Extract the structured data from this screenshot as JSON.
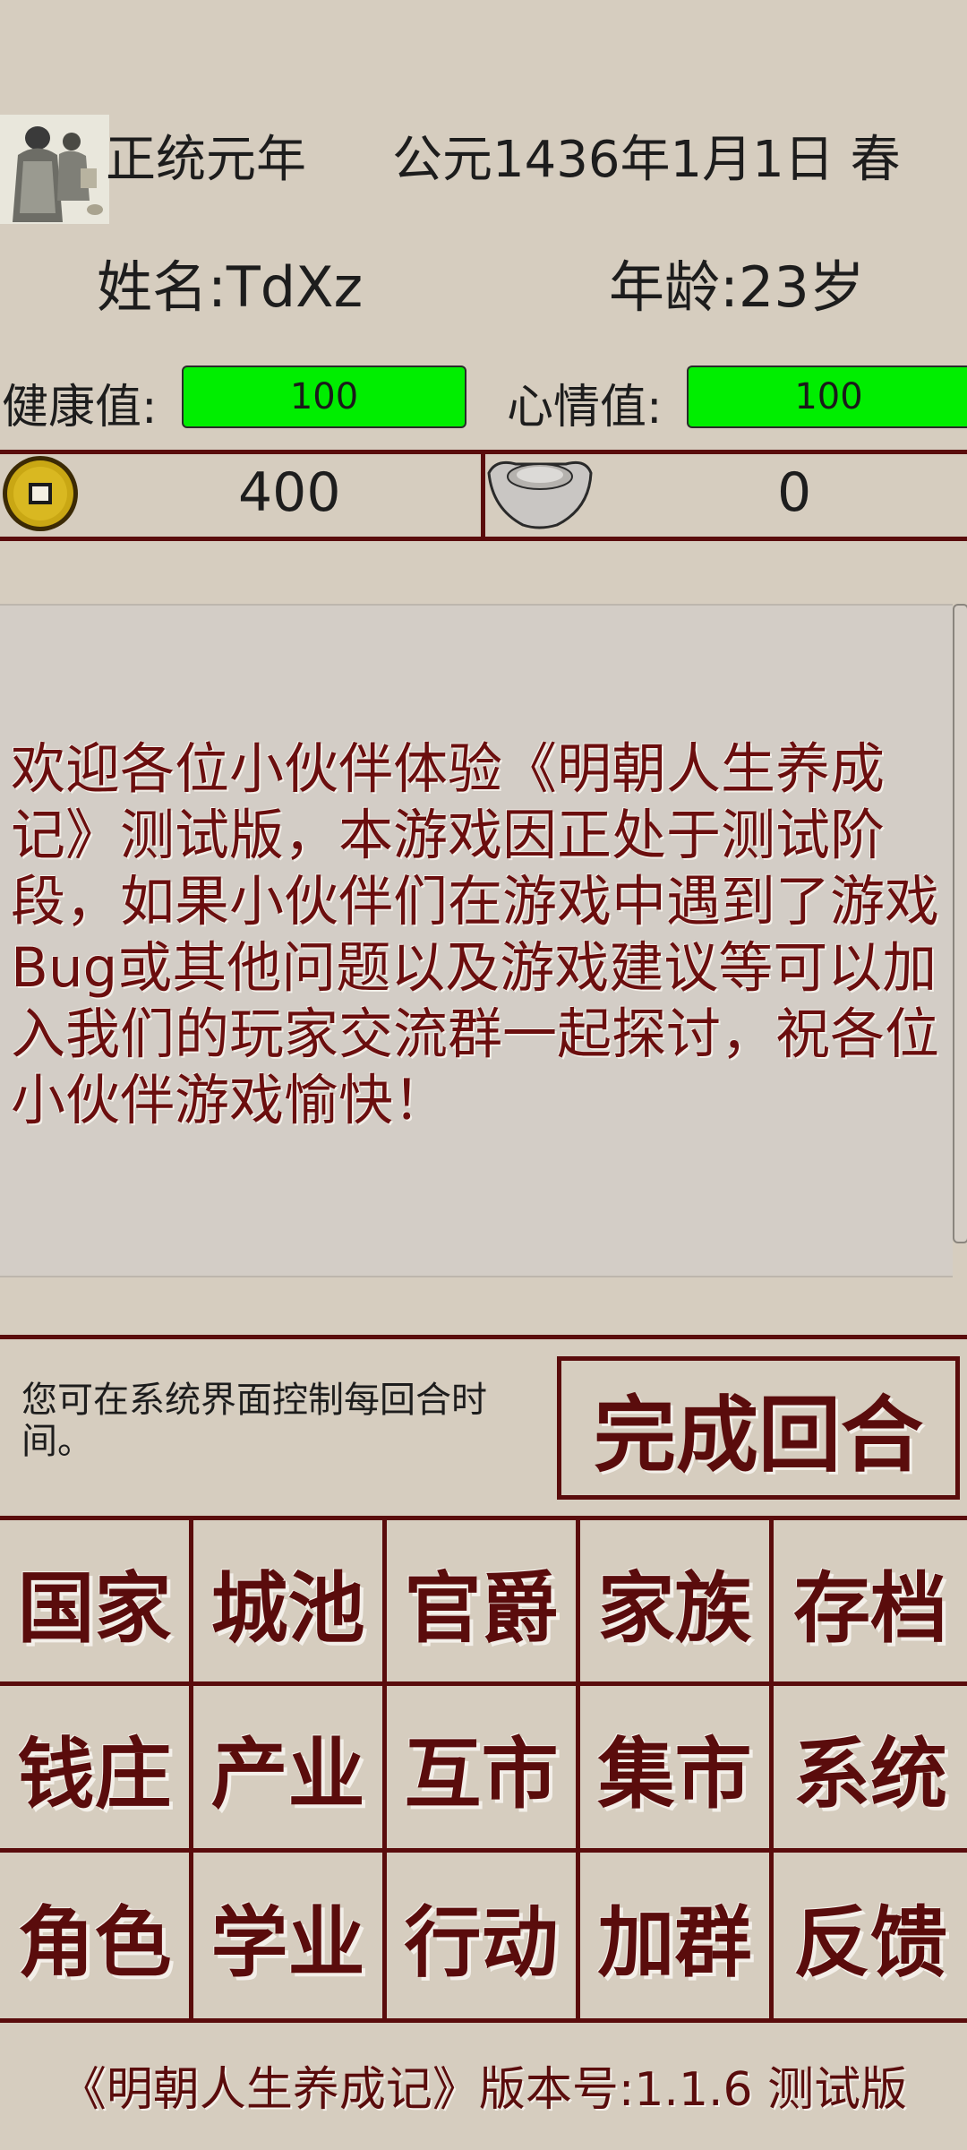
{
  "header": {
    "era": "正统元年",
    "date": "公元1436年1月1日 春",
    "name": "姓名:TdXz",
    "age": "年龄:23岁"
  },
  "stats": {
    "health_label": "健康值:",
    "health_value": "100",
    "mood_label": "心情值:",
    "mood_value": "100"
  },
  "currency": {
    "coins": "400",
    "silver": "0"
  },
  "message": "欢迎各位小伙伴体验《明朝人生养成记》测试版，本游戏因正处于测试阶段，如果小伙伴们在游戏中遇到了游戏Bug或其他问题以及游戏建议等可以加入我们的玩家交流群一起探讨，祝各位小伙伴游戏愉快！",
  "turn": {
    "hint": "您可在系统界面控制每回合时间。",
    "finish_label": "完成回合"
  },
  "menu": [
    "国家",
    "城池",
    "官爵",
    "家族",
    "存档",
    "钱庄",
    "产业",
    "互市",
    "集市",
    "系统",
    "角色",
    "学业",
    "行动",
    "加群",
    "反馈"
  ],
  "footer": "《明朝人生养成记》版本号:1.1.6 测试版",
  "colors": {
    "accent": "#5a0c0c",
    "bar": "#00ee00",
    "background": "#d6cdbf"
  }
}
